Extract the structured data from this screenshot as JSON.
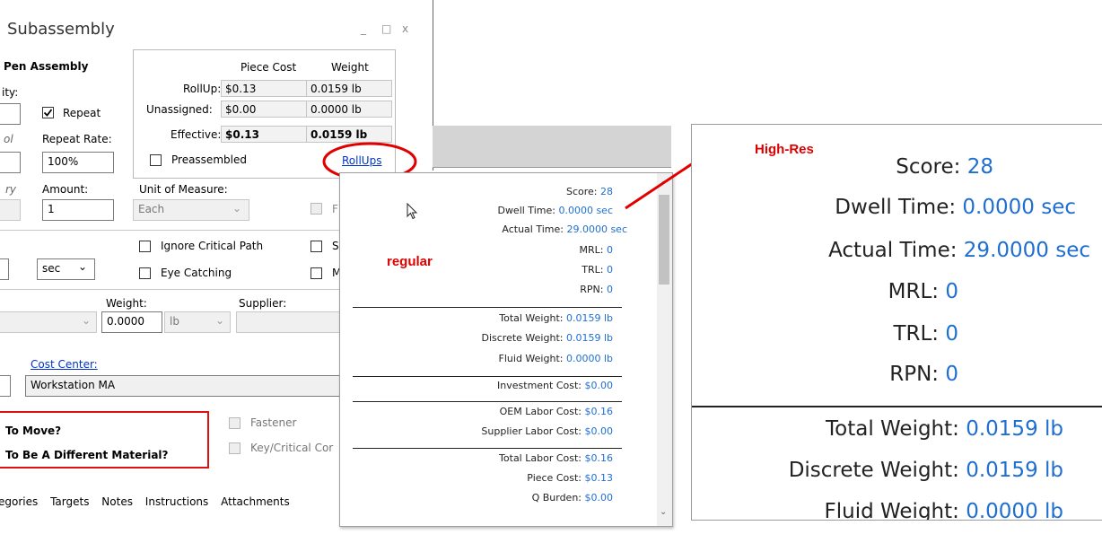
{
  "window": {
    "title": "Subassembly",
    "controls": [
      "_",
      "□",
      "x"
    ],
    "assembly_name": "Pen Assembly",
    "quantity_label": "ity:",
    "repeat_label": "Repeat",
    "repeat_rate_label": "Repeat Rate:",
    "repeat_rate_value": "100%",
    "partial_label_l": "ol",
    "partial_label_ry": "ry",
    "amount_label": "Amount:",
    "amount_value": "1",
    "uom_label": "Unit of Measure:",
    "uom_value": "Each",
    "time_unit": "sec",
    "ignore_critical_path": "Ignore Critical Path",
    "eye_catching": "Eye Catching",
    "partial_s": "S",
    "partial_m": "M",
    "partial_f": "F",
    "weight_label": "Weight:",
    "weight_value": "0.0000",
    "weight_unit": "lb",
    "supplier_label": "Supplier:",
    "cost_center_label": "Cost Center:",
    "cost_center_value": "Workstation MA",
    "q_move": "To Move?",
    "q_material": "To Be A Different Material?",
    "fastener": "Fastener",
    "key_critical": "Key/Critical Cor",
    "tabs": [
      "egories",
      "Targets",
      "Notes",
      "Instructions",
      "Attachments"
    ],
    "rollup": {
      "col_piece": "Piece Cost",
      "col_weight": "Weight",
      "rows": [
        {
          "label": "RollUp:",
          "piece": "$0.13",
          "weight": "0.0159 lb"
        },
        {
          "label": "Unassigned:",
          "piece": "$0.00",
          "weight": "0.0000 lb"
        },
        {
          "label": "Effective:",
          "piece": "$0.13",
          "weight": "0.0159 lb"
        }
      ],
      "preassembled": "Preassembled",
      "link": "RollUps"
    }
  },
  "annotations": {
    "regular": "regular",
    "high_res": "High-Res"
  },
  "popup": {
    "rows": [
      {
        "k": "Score:",
        "v": "28"
      },
      {
        "k": "Dwell Time:",
        "v": "0.0000 sec"
      },
      {
        "k": "Actual Time:",
        "v": "29.0000 sec"
      },
      {
        "k": "MRL:",
        "v": "0"
      },
      {
        "k": "TRL:",
        "v": "0"
      },
      {
        "k": "RPN:",
        "v": "0"
      },
      {
        "k": "Total Weight:",
        "v": "0.0159 lb"
      },
      {
        "k": "Discrete Weight:",
        "v": "0.0159 lb"
      },
      {
        "k": "Fluid Weight:",
        "v": "0.0000 lb"
      },
      {
        "k": "Investment Cost:",
        "v": "$0.00"
      },
      {
        "k": "OEM Labor Cost:",
        "v": "$0.16"
      },
      {
        "k": "Supplier Labor Cost:",
        "v": "$0.00"
      },
      {
        "k": "Total Labor Cost:",
        "v": "$0.16"
      },
      {
        "k": "Piece Cost:",
        "v": "$0.13"
      },
      {
        "k": "Q Burden:",
        "v": "$0.00"
      }
    ]
  },
  "hires": {
    "rows": [
      {
        "k": "Score:",
        "v": "28"
      },
      {
        "k": "Dwell Time:",
        "v": "0.0000 sec"
      },
      {
        "k": "Actual Time:",
        "v": "29.0000 sec"
      },
      {
        "k": "MRL:",
        "v": "0"
      },
      {
        "k": "TRL:",
        "v": "0"
      },
      {
        "k": "RPN:",
        "v": "0"
      },
      {
        "k": "Total Weight:",
        "v": "0.0159 lb"
      },
      {
        "k": "Discrete Weight:",
        "v": "0.0159 lb"
      },
      {
        "k": "Fluid Weight:",
        "v": "0.0000 lb"
      }
    ]
  }
}
